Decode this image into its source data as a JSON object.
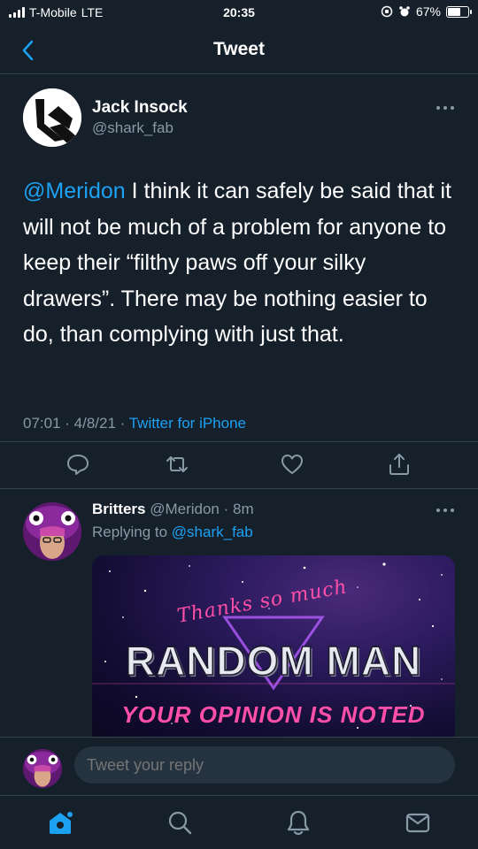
{
  "status_bar": {
    "carrier": "T-Mobile",
    "network": "LTE",
    "time": "20:35",
    "battery": "67%",
    "battery_level": 0.67
  },
  "nav": {
    "title": "Tweet"
  },
  "tweet": {
    "author_name": "Jack Insock",
    "author_handle": "@shark_fab",
    "mention": "@Meridon",
    "text": " I think it can safely be said that it will not be much of a problem for anyone to keep their “filthy paws off your silky drawers”. There may be nothing easier to do, than complying with just that.",
    "meta": "07:01 · 4/8/21 · ",
    "source": "Twitter for iPhone"
  },
  "reply": {
    "author_name": "Britters",
    "author_handle": "@Meridon",
    "age": "· 8m",
    "replying_prefix": "Replying to",
    "replying_to": "@shark_fab",
    "media": {
      "line1": "Thanks so much",
      "line2": "RANDOM MAN",
      "line3": "YOUR OPINION IS NOTED"
    }
  },
  "reply_bar": {
    "placeholder": "Tweet your reply"
  },
  "icons": {
    "back": "chevron-left-icon",
    "more": "more-icon",
    "comment": "comment-icon",
    "retweet": "retweet-icon",
    "like": "heart-icon",
    "share": "share-icon",
    "home": "home-icon",
    "search": "search-icon",
    "notifications": "bell-icon",
    "messages": "mail-icon"
  },
  "colors": {
    "background": "#15202b",
    "accent": "#1da1f2",
    "secondary_text": "#8899a6",
    "border": "#38444d"
  }
}
